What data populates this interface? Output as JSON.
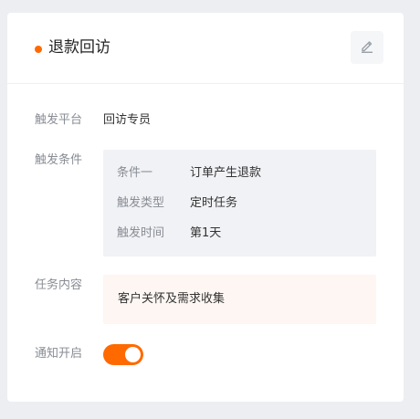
{
  "colors": {
    "accent": "#ff6a00"
  },
  "header": {
    "title": "退款回访",
    "edit_icon": "pencil-icon"
  },
  "fields": {
    "platform": {
      "label": "触发平台",
      "value": "回访专员"
    },
    "conditions": {
      "label": "触发条件",
      "items": [
        {
          "key": "条件一",
          "value": "订单产生退款"
        },
        {
          "key": "触发类型",
          "value": "定时任务"
        },
        {
          "key": "触发时间",
          "value": "第1天"
        }
      ]
    },
    "task": {
      "label": "任务内容",
      "value": "客户关怀及需求收集"
    },
    "notify": {
      "label": "通知开启",
      "enabled": true
    }
  }
}
